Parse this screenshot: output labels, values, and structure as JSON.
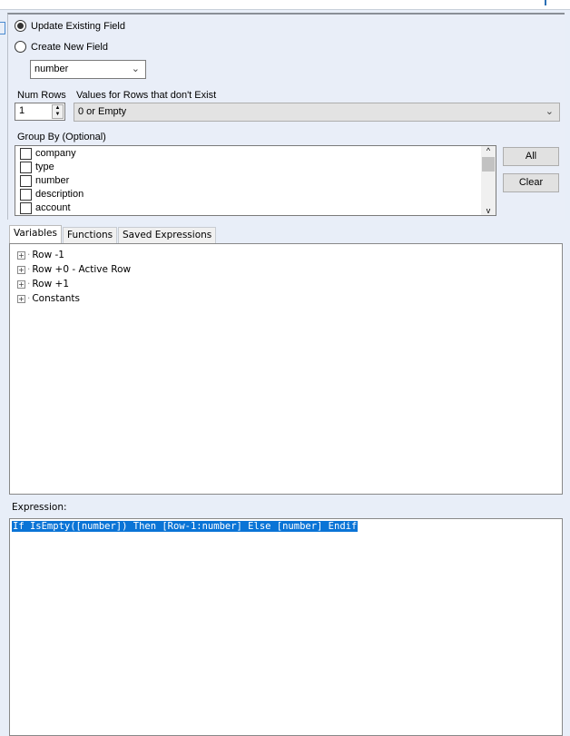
{
  "mode": {
    "update_label": "Update Existing Field",
    "create_label": "Create New  Field",
    "selected": "update"
  },
  "field_select": {
    "value": "number"
  },
  "num_rows": {
    "label": "Num Rows",
    "value": "1"
  },
  "missing_rows": {
    "label": "Values for Rows that don't Exist",
    "value": "0 or Empty"
  },
  "group_by": {
    "label": "Group By (Optional)",
    "items": [
      "company",
      "type",
      "number",
      "description",
      "account"
    ],
    "all_label": "All",
    "clear_label": "Clear"
  },
  "tabs": [
    "Variables",
    "Functions",
    "Saved Expressions"
  ],
  "variables": [
    "Row -1",
    "Row +0 - Active Row",
    "Row +1",
    "Constants"
  ],
  "expression": {
    "label": "Expression:",
    "value": "If IsEmpty([number]) Then [Row-1:number] Else [number] Endif"
  }
}
